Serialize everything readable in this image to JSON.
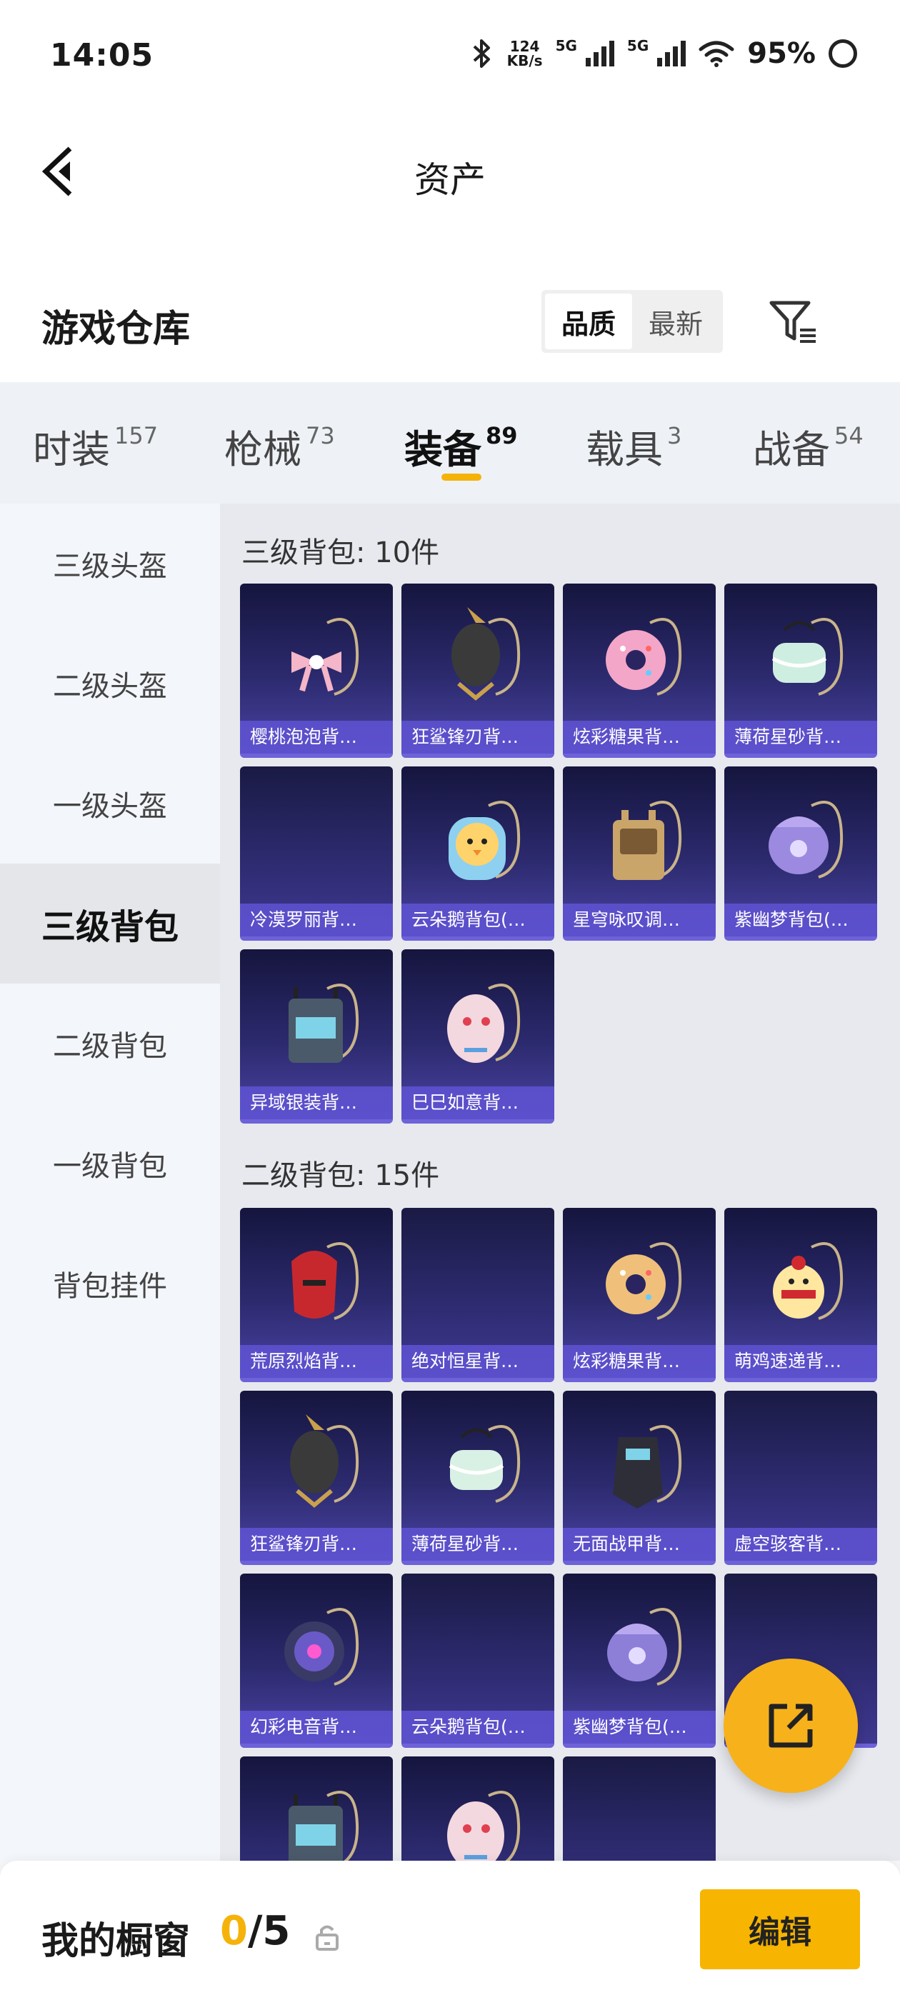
{
  "status_bar": {
    "time": "14:05",
    "net_speed_top": "124",
    "net_speed_unit": "KB/s",
    "sim1": "5G",
    "sim2": "5G",
    "battery": "95%"
  },
  "nav": {
    "title": "资产"
  },
  "warehouse": {
    "title": "游戏仓库",
    "sort_options": [
      "品质",
      "最新"
    ],
    "sort_active": "品质"
  },
  "tabs": [
    {
      "label": "时装",
      "count": "157"
    },
    {
      "label": "枪械",
      "count": "73"
    },
    {
      "label": "装备",
      "count": "89"
    },
    {
      "label": "载具",
      "count": "3"
    },
    {
      "label": "战备",
      "count": "54"
    }
  ],
  "sidebar": [
    {
      "label": "三级头盔"
    },
    {
      "label": "二级头盔"
    },
    {
      "label": "一级头盔"
    },
    {
      "label": "三级背包"
    },
    {
      "label": "二级背包"
    },
    {
      "label": "一级背包"
    },
    {
      "label": "背包挂件"
    }
  ],
  "sections": [
    {
      "title": "三级背包: 10件",
      "items": [
        {
          "name": "樱桃泡泡背…",
          "art": "pink-bow",
          "color": "#f4b6c8"
        },
        {
          "name": "狂鲨锋刃背…",
          "art": "shark",
          "color": "#3a3a3a"
        },
        {
          "name": "炫彩糖果背…",
          "art": "donut",
          "color": "#f4a6c8"
        },
        {
          "name": "薄荷星砂背…",
          "art": "mint",
          "color": "#cfeee2"
        },
        {
          "name": "冷漠罗丽背…",
          "art": "",
          "color": ""
        },
        {
          "name": "云朵鹅背包(…",
          "art": "goose",
          "color": "#ffd36b"
        },
        {
          "name": "星穹咏叹调…",
          "art": "gold-case",
          "color": "#c9a56a"
        },
        {
          "name": "紫幽梦背包(…",
          "art": "purple",
          "color": "#9b8ae0"
        },
        {
          "name": "异域银装背…",
          "art": "tech",
          "color": "#4a5a6a"
        },
        {
          "name": "巳巳如意背…",
          "art": "snake",
          "color": "#f4d8df"
        }
      ]
    },
    {
      "title": "二级背包: 15件",
      "items": [
        {
          "name": "荒原烈焰背…",
          "art": "red-mask",
          "color": "#c7282e"
        },
        {
          "name": "绝对恒星背…",
          "art": "",
          "color": ""
        },
        {
          "name": "炫彩糖果背…",
          "art": "donut",
          "color": "#f0c07a"
        },
        {
          "name": "萌鸡速递背…",
          "art": "chick",
          "color": "#ffe7a0"
        },
        {
          "name": "狂鲨锋刃背…",
          "art": "shark",
          "color": "#3a3a3a"
        },
        {
          "name": "薄荷星砂背…",
          "art": "mint",
          "color": "#d9f1e4"
        },
        {
          "name": "无面战甲背…",
          "art": "armor",
          "color": "#2e2e38"
        },
        {
          "name": "虚空骇客背…",
          "art": "",
          "color": ""
        },
        {
          "name": "幻彩电音背…",
          "art": "speaker",
          "color": "#6a5ac8"
        },
        {
          "name": "云朵鹅背包(…",
          "art": "",
          "color": ""
        },
        {
          "name": "紫幽梦背包(…",
          "art": "purple",
          "color": "#8d7ed8"
        },
        {
          "name": "",
          "art": "",
          "color": ""
        },
        {
          "name": "",
          "art": "tech",
          "color": "#4a5a6a"
        },
        {
          "name": "",
          "art": "snake",
          "color": "#f4d8df"
        },
        {
          "name": "",
          "art": "",
          "color": ""
        }
      ]
    }
  ],
  "bottom": {
    "label": "我的橱窗",
    "used": "0",
    "total": "/5",
    "edit_label": "编辑"
  },
  "colors": {
    "accent": "#f5b30a",
    "card_label_bg": "#5f52d2",
    "card_bg_top": "#15153e",
    "card_bg_bottom": "#4a43a3"
  }
}
